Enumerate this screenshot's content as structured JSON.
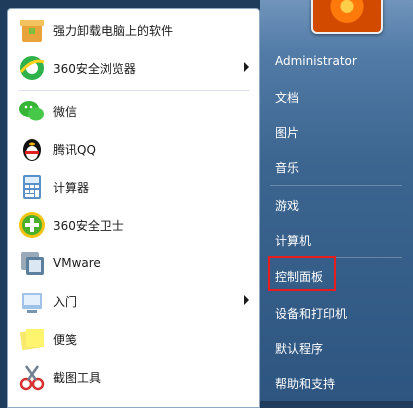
{
  "programs": [
    {
      "label": "强力卸载电脑上的软件",
      "icon": "uninstall-box-icon",
      "submenu": false
    },
    {
      "label": "360安全浏览器",
      "icon": "360-browser-icon",
      "submenu": true
    },
    {
      "label": "微信",
      "icon": "wechat-icon",
      "submenu": false
    },
    {
      "label": "腾讯QQ",
      "icon": "qq-penguin-icon",
      "submenu": false
    },
    {
      "label": "计算器",
      "icon": "calculator-icon",
      "submenu": false
    },
    {
      "label": "360安全卫士",
      "icon": "360-guard-icon",
      "submenu": false
    },
    {
      "label": "VMware",
      "icon": "vmware-icon",
      "submenu": false
    },
    {
      "label": "入门",
      "icon": "getting-started-icon",
      "submenu": true
    },
    {
      "label": "便笺",
      "icon": "sticky-notes-icon",
      "submenu": false
    },
    {
      "label": "截图工具",
      "icon": "snipping-tool-icon",
      "submenu": false
    }
  ],
  "right_pane": {
    "user": "Administrator",
    "items": [
      "文档",
      "图片",
      "音乐",
      "游戏",
      "计算机",
      "控制面板",
      "设备和打印机",
      "默认程序",
      "帮助和支持"
    ],
    "highlighted": "控制面板"
  },
  "colors": {
    "highlight": "#e81d1d",
    "pane": "#3c6590"
  }
}
